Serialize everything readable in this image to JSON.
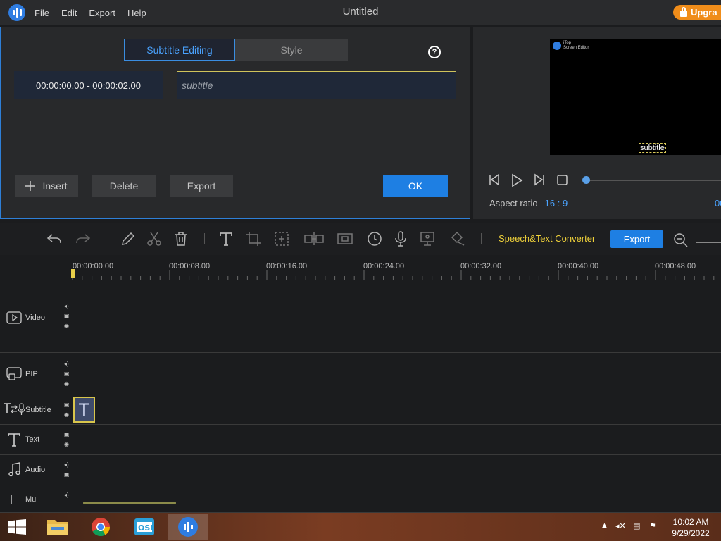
{
  "app": {
    "title": "Untitled",
    "menu": [
      "File",
      "Edit",
      "Export",
      "Help"
    ],
    "upgrade_label": "Upgra"
  },
  "subtitle_panel": {
    "tabs": [
      {
        "label": "Subtitle Editing",
        "active": true
      },
      {
        "label": "Style",
        "active": false
      }
    ],
    "help_label": "?",
    "rows": [
      {
        "time": "00:00:00.00 - 00:00:02.00",
        "text": "",
        "placeholder": "subtitle"
      }
    ],
    "buttons": {
      "insert": "Insert",
      "delete": "Delete",
      "export": "Export",
      "ok": "OK"
    }
  },
  "preview": {
    "watermark": [
      "iTop",
      "Screen Editor"
    ],
    "overlay_text": "subtitle",
    "aspect_label": "Aspect ratio",
    "aspect_value": "16 : 9",
    "right_text": "00",
    "progress": 0
  },
  "toolbar": {
    "speech_text": "Speech&Text Converter",
    "export_label": "Export"
  },
  "timeline": {
    "ticks": [
      "00:00:00.00",
      "00:00:08.00",
      "00:00:16.00",
      "00:00:24.00",
      "00:00:32.00",
      "00:00:40.00",
      "00:00:48.00"
    ],
    "tracks": [
      {
        "name": "Video"
      },
      {
        "name": "PIP"
      },
      {
        "name": "Subtitle"
      },
      {
        "name": "Text"
      },
      {
        "name": "Audio"
      },
      {
        "name": "Mu"
      }
    ],
    "subtitle_clip_glyph": "T"
  },
  "taskbar": {
    "time": "10:02 AM",
    "date": "9/29/2022",
    "accent": "#2f7de1"
  }
}
